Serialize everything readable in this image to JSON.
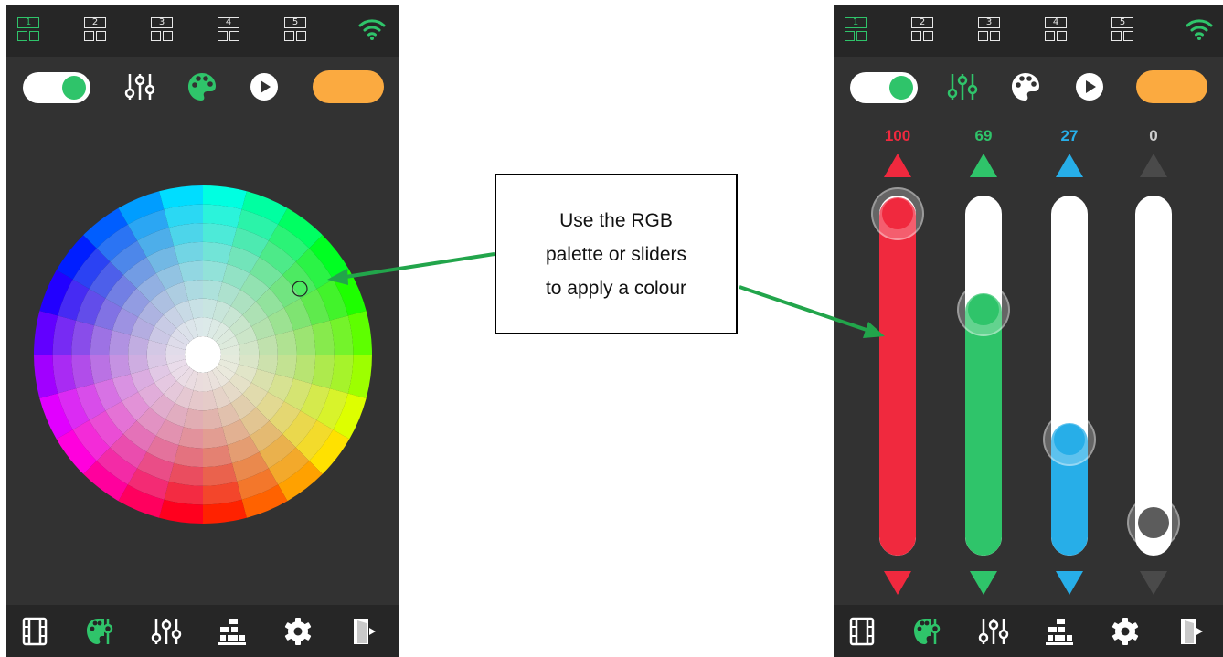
{
  "callout": {
    "text": "Use the RGB\npalette or sliders\nto apply a colour"
  },
  "zones": [
    "1",
    "2",
    "3",
    "4",
    "5"
  ],
  "colors": {
    "accent_green": "#2fc46a",
    "bar_bg": "#262626",
    "panel_bg": "#323232",
    "orange_pill": "#fbaa40",
    "red": "#f0293e",
    "green": "#2fc46a",
    "blue": "#27aee8",
    "grey": "#5c5c5c"
  },
  "left_screen": {
    "active_zone": "1",
    "active_tool": "palette-icon",
    "toolbar_icons": [
      "power-toggle",
      "sliders-icon",
      "palette-icon",
      "play-icon",
      "color-preview-pill"
    ],
    "bottom_icons": [
      "film-icon",
      "palette-sliders-icon",
      "sliders-icon",
      "bricks-icon",
      "gear-icon",
      "exit-icon"
    ]
  },
  "right_screen": {
    "active_zone": "1",
    "active_tool": "sliders-icon",
    "sliders": [
      {
        "name": "red",
        "value_label": "100",
        "value": 100,
        "color": "#f0293e"
      },
      {
        "name": "green",
        "value_label": "69",
        "value": 69,
        "color": "#2fc46a"
      },
      {
        "name": "blue",
        "value_label": "27",
        "value": 27,
        "color": "#27aee8"
      },
      {
        "name": "white",
        "value_label": "0",
        "value": 0,
        "color": "#5c5c5c"
      }
    ]
  }
}
